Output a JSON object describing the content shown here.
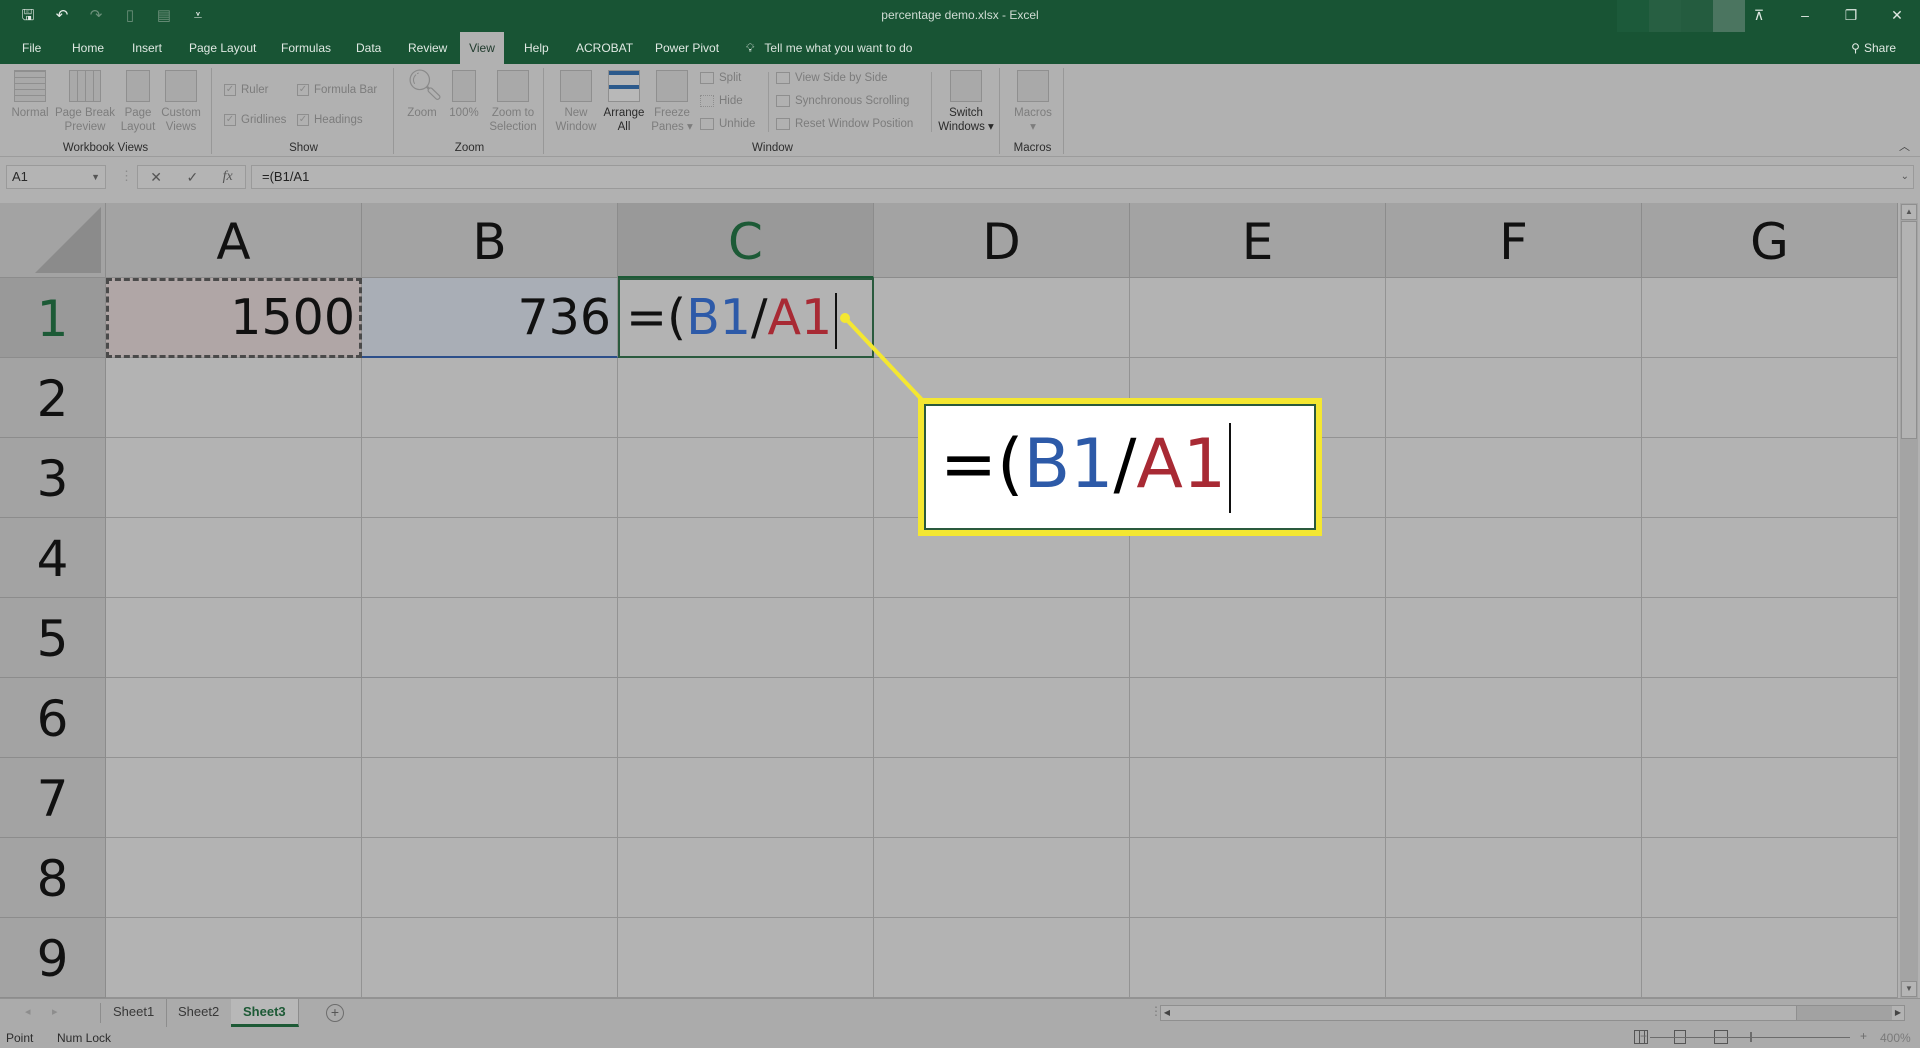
{
  "titlebar": {
    "document_title": "percentage demo.xlsx  -  Excel",
    "qat": [
      {
        "name": "save-icon",
        "glyph": "🖫"
      },
      {
        "name": "undo-icon",
        "glyph": "↶"
      },
      {
        "name": "redo-icon",
        "glyph": "↷"
      },
      {
        "name": "new-file-icon",
        "glyph": "▯"
      },
      {
        "name": "form-icon",
        "glyph": "▤"
      },
      {
        "name": "customize-qat-icon",
        "glyph": "⩡"
      }
    ],
    "window_controls": {
      "ribbon_display": "⊼",
      "minimize": "–",
      "restore": "❐",
      "close": "✕"
    }
  },
  "tabs": [
    {
      "label": "File"
    },
    {
      "label": "Home"
    },
    {
      "label": "Insert"
    },
    {
      "label": "Page Layout"
    },
    {
      "label": "Formulas"
    },
    {
      "label": "Data"
    },
    {
      "label": "Review"
    },
    {
      "label": "View",
      "active": true
    },
    {
      "label": "Help"
    },
    {
      "label": "ACROBAT"
    },
    {
      "label": "Power Pivot"
    }
  ],
  "tell_me": "Tell me what you want to do",
  "share_label": "Share",
  "ribbon": {
    "workbook_views": {
      "label": "Workbook Views",
      "buttons": [
        {
          "line1": "Normal",
          "line2": ""
        },
        {
          "line1": "Page Break",
          "line2": "Preview"
        },
        {
          "line1": "Page",
          "line2": "Layout"
        },
        {
          "line1": "Custom",
          "line2": "Views"
        }
      ]
    },
    "show": {
      "label": "Show",
      "checkboxes": [
        {
          "label": "Ruler",
          "checked": true
        },
        {
          "label": "Formula Bar",
          "checked": true
        },
        {
          "label": "Gridlines",
          "checked": true
        },
        {
          "label": "Headings",
          "checked": true
        }
      ]
    },
    "zoom": {
      "label": "Zoom",
      "buttons": [
        {
          "line1": "Zoom",
          "line2": ""
        },
        {
          "line1": "100%",
          "line2": ""
        },
        {
          "line1": "Zoom to",
          "line2": "Selection"
        }
      ]
    },
    "window": {
      "label": "Window",
      "buttons": [
        {
          "line1": "New",
          "line2": "Window"
        },
        {
          "line1": "Arrange",
          "line2": "All"
        },
        {
          "line1": "Freeze",
          "line2": "Panes ▾"
        }
      ],
      "small": [
        {
          "label": "Split"
        },
        {
          "label": "Hide"
        },
        {
          "label": "Unhide"
        },
        {
          "label": "View Side by Side"
        },
        {
          "label": "Synchronous Scrolling"
        },
        {
          "label": "Reset Window Position"
        }
      ],
      "switch": {
        "line1": "Switch",
        "line2": "Windows ▾"
      }
    },
    "macros": {
      "label": "Macros",
      "button": {
        "line1": "Macros",
        "line2": "▾"
      }
    }
  },
  "formula_bar": {
    "name_box": "A1",
    "cancel": "✕",
    "enter": "✓",
    "fx": "fx",
    "formula": "=(B1/A1"
  },
  "grid": {
    "columns": [
      "A",
      "B",
      "C",
      "D",
      "E",
      "F",
      "G"
    ],
    "rows": [
      "1",
      "2",
      "3",
      "4",
      "5",
      "6",
      "7",
      "8",
      "9"
    ],
    "cells": {
      "A1": "1500",
      "B1": "736",
      "C1": {
        "prefix": "=(",
        "ref1": "B1",
        "op": "/",
        "ref2": "A1"
      }
    }
  },
  "callout": {
    "prefix": "=(",
    "ref1": "B1",
    "op": "/",
    "ref2": "A1",
    "color": "#f4e731"
  },
  "sheets": [
    {
      "label": "Sheet1"
    },
    {
      "label": "Sheet2"
    },
    {
      "label": "Sheet3",
      "active": true
    }
  ],
  "status": {
    "mode": "Point",
    "num_lock": "Num Lock",
    "zoom_level": "400%"
  },
  "colors": {
    "excel_green": "#185434",
    "ref_blue": "#2d5aa8",
    "ref_red": "#a82a34"
  }
}
